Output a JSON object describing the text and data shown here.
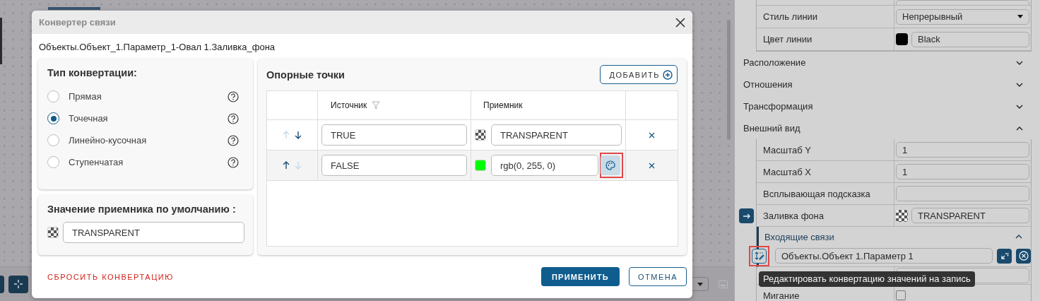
{
  "dialog": {
    "title": "Конвертер связи",
    "path": "Объекты.Объект_1.Параметр_1-Овал 1.Заливка_фона",
    "conversion": {
      "title": "Тип конвертации:",
      "options": [
        {
          "label": "Прямая",
          "selected": false
        },
        {
          "label": "Точечная",
          "selected": true
        },
        {
          "label": "Линейно-кусочная",
          "selected": false
        },
        {
          "label": "Ступенчатая",
          "selected": false
        }
      ]
    },
    "default_value": {
      "title": "Значение приемника по умолчанию :",
      "value": "TRANSPARENT",
      "swatch": {
        "kind": "checker"
      }
    },
    "points": {
      "title": "Опорные точки",
      "add_button": "ДОБАВИТЬ",
      "columns": [
        "Источник",
        "Приемник"
      ],
      "rows": [
        {
          "up_disabled": true,
          "down_disabled": false,
          "source": "TRUE",
          "swatch": {
            "kind": "checker"
          },
          "target": "TRANSPARENT",
          "palette_button": false
        },
        {
          "up_disabled": false,
          "down_disabled": true,
          "source": "FALSE",
          "swatch": {
            "kind": "color",
            "color": "#00ff00"
          },
          "target": "rgb(0, 255, 0)",
          "palette_button": true,
          "highlighted": true
        }
      ]
    },
    "reset_button": "СБРОСИТЬ КОНВЕРТАЦИЮ",
    "apply_button": "ПРИМЕНИТЬ",
    "cancel_button": "ОТМЕНА"
  },
  "properties": {
    "line_rows": [
      {
        "label": "Стиль линии",
        "kind": "select",
        "value": "Непрерывный"
      },
      {
        "label": "Цвет линии",
        "kind": "color",
        "value": "Black",
        "color": "#000000"
      }
    ],
    "sections": [
      {
        "title": "Расположение",
        "expanded": false
      },
      {
        "title": "Отношения",
        "expanded": false
      },
      {
        "title": "Трансформация",
        "expanded": false
      },
      {
        "title": "Внешний вид",
        "expanded": true
      }
    ],
    "appearance_rows": [
      {
        "label": "Масштаб Y",
        "kind": "text",
        "value": "1"
      },
      {
        "label": "Масштаб X",
        "kind": "text",
        "value": "1"
      },
      {
        "label": "Всплывающая подсказка",
        "kind": "text",
        "value": ""
      },
      {
        "label": "Заливка фона",
        "kind": "checker",
        "value": "TRANSPARENT",
        "linked": true
      }
    ],
    "incoming": {
      "title": "Входящие связи",
      "expanded": true,
      "link": "Объекты.Объект 1.Параметр 1",
      "edit_highlighted": true
    },
    "tooltip": "Редактировать конвертацию значений на запись",
    "last_row": {
      "label": "Мигание",
      "checked": false
    }
  }
}
